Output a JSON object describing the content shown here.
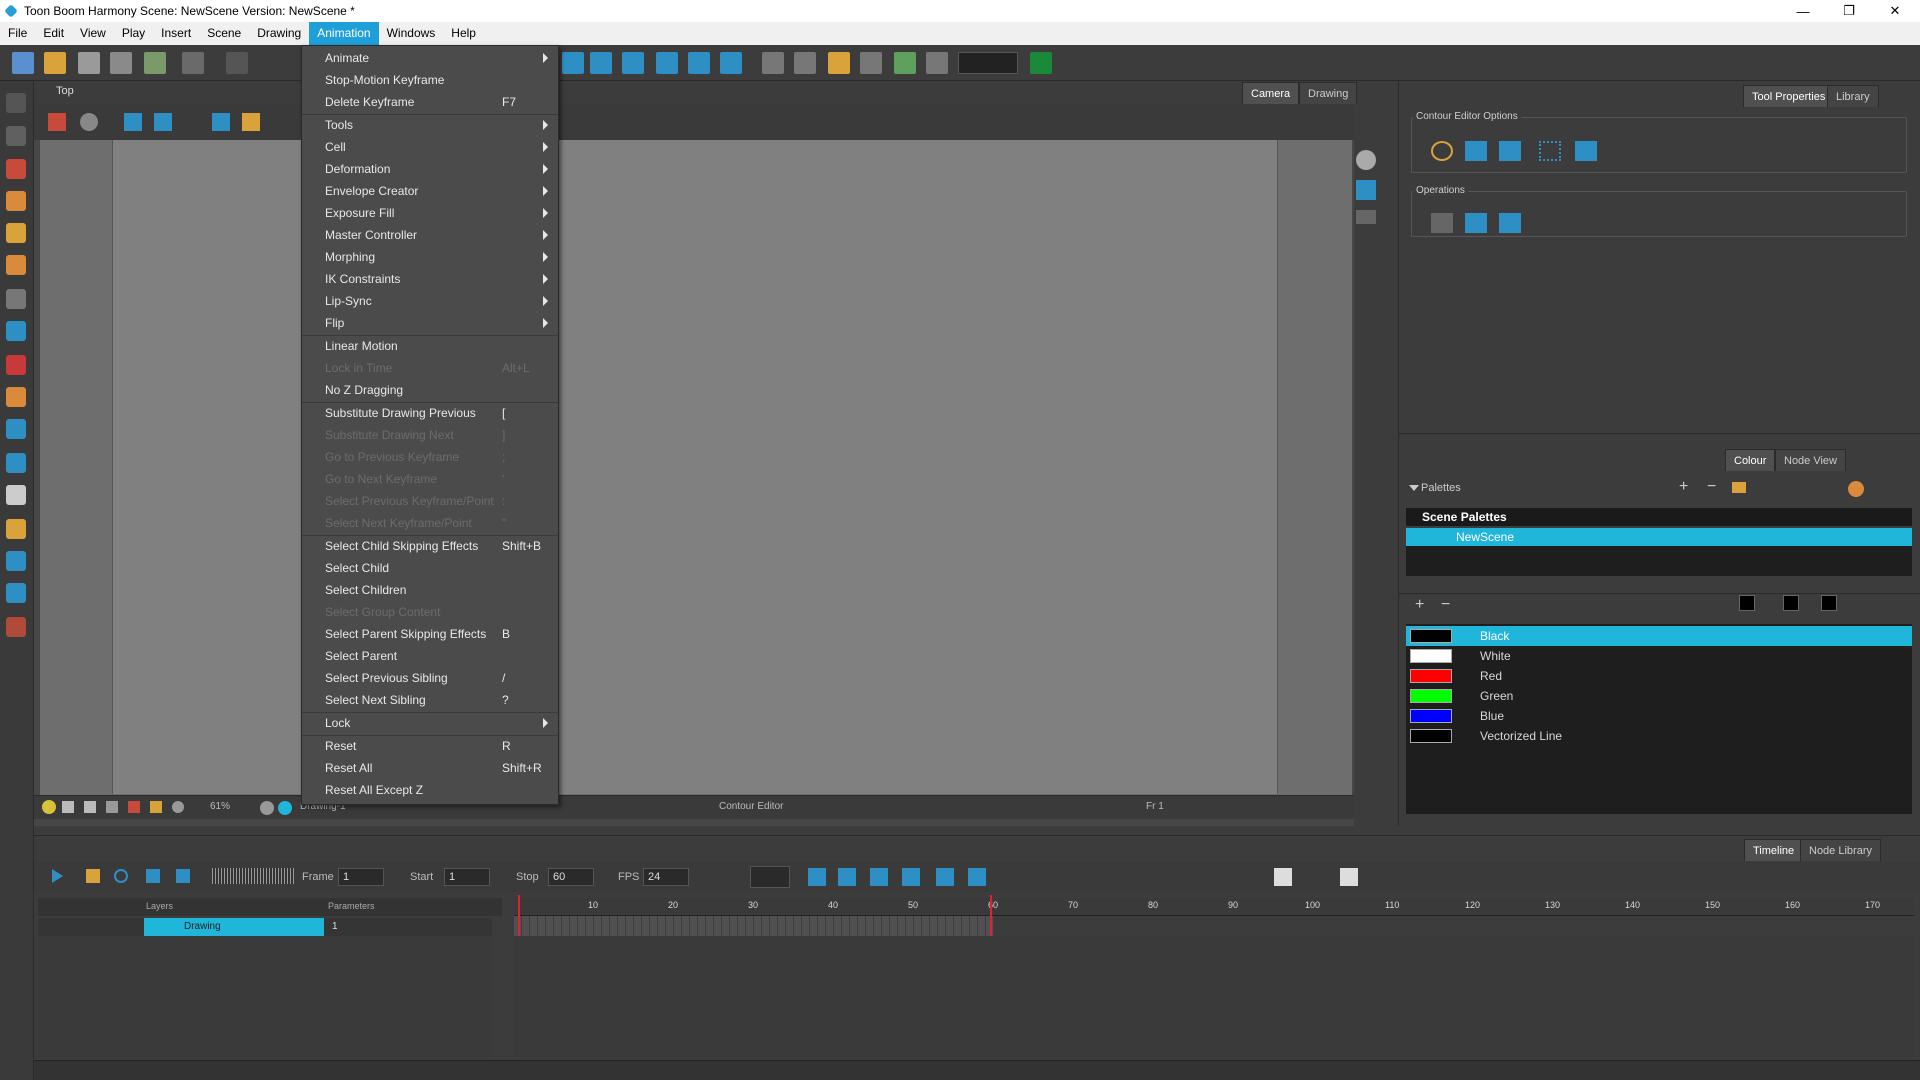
{
  "window": {
    "title": "Toon Boom Harmony Scene: NewScene Version: NewScene *",
    "minimize": "—",
    "maximize": "❐",
    "close": "✕"
  },
  "menubar": [
    "File",
    "Edit",
    "View",
    "Play",
    "Insert",
    "Scene",
    "Drawing",
    "Animation",
    "Windows",
    "Help"
  ],
  "active_menu": "Animation",
  "dropdown": [
    {
      "label": "Animate",
      "shortcut": "",
      "submenu": true,
      "enabled": true
    },
    {
      "label": "Stop-Motion Keyframe",
      "shortcut": "",
      "submenu": false,
      "enabled": true
    },
    {
      "label": "Delete Keyframe",
      "shortcut": "F7",
      "submenu": false,
      "enabled": true
    },
    {
      "label": "Tools",
      "shortcut": "",
      "submenu": true,
      "enabled": true,
      "sep": true
    },
    {
      "label": "Cell",
      "shortcut": "",
      "submenu": true,
      "enabled": true
    },
    {
      "label": "Deformation",
      "shortcut": "",
      "submenu": true,
      "enabled": true
    },
    {
      "label": "Envelope Creator",
      "shortcut": "",
      "submenu": true,
      "enabled": true
    },
    {
      "label": "Exposure Fill",
      "shortcut": "",
      "submenu": true,
      "enabled": true
    },
    {
      "label": "Master Controller",
      "shortcut": "",
      "submenu": true,
      "enabled": true
    },
    {
      "label": "Morphing",
      "shortcut": "",
      "submenu": true,
      "enabled": true
    },
    {
      "label": "IK Constraints",
      "shortcut": "",
      "submenu": true,
      "enabled": true
    },
    {
      "label": "Lip-Sync",
      "shortcut": "",
      "submenu": true,
      "enabled": true
    },
    {
      "label": "Flip",
      "shortcut": "",
      "submenu": true,
      "enabled": true
    },
    {
      "label": "Linear Motion",
      "shortcut": "",
      "submenu": false,
      "enabled": true,
      "sep": true
    },
    {
      "label": "Lock in Time",
      "shortcut": "Alt+L",
      "submenu": false,
      "enabled": false
    },
    {
      "label": "No Z Dragging",
      "shortcut": "",
      "submenu": false,
      "enabled": true
    },
    {
      "label": "Substitute Drawing Previous",
      "shortcut": "[",
      "submenu": false,
      "enabled": true,
      "sep": true
    },
    {
      "label": "Substitute Drawing Next",
      "shortcut": "]",
      "submenu": false,
      "enabled": false
    },
    {
      "label": "Go to Previous Keyframe",
      "shortcut": ";",
      "submenu": false,
      "enabled": false
    },
    {
      "label": "Go to Next Keyframe",
      "shortcut": "'",
      "submenu": false,
      "enabled": false
    },
    {
      "label": "Select Previous Keyframe/Point",
      "shortcut": ":",
      "submenu": false,
      "enabled": false
    },
    {
      "label": "Select Next Keyframe/Point",
      "shortcut": "\"",
      "submenu": false,
      "enabled": false
    },
    {
      "label": "Select Child Skipping Effects",
      "shortcut": "Shift+B",
      "submenu": false,
      "enabled": true,
      "sep": true
    },
    {
      "label": "Select Child",
      "shortcut": "",
      "submenu": false,
      "enabled": true
    },
    {
      "label": "Select Children",
      "shortcut": "",
      "submenu": false,
      "enabled": true
    },
    {
      "label": "Select Group Content",
      "shortcut": "",
      "submenu": false,
      "enabled": false
    },
    {
      "label": "Select Parent Skipping Effects",
      "shortcut": "B",
      "submenu": false,
      "enabled": true
    },
    {
      "label": "Select Parent",
      "shortcut": "",
      "submenu": false,
      "enabled": true
    },
    {
      "label": "Select Previous Sibling",
      "shortcut": "/",
      "submenu": false,
      "enabled": true
    },
    {
      "label": "Select Next Sibling",
      "shortcut": "?",
      "submenu": false,
      "enabled": true
    },
    {
      "label": "Lock",
      "shortcut": "",
      "submenu": true,
      "enabled": true,
      "sep": true
    },
    {
      "label": "Reset",
      "shortcut": "R",
      "submenu": false,
      "enabled": true,
      "sep": true
    },
    {
      "label": "Reset All",
      "shortcut": "Shift+R",
      "submenu": false,
      "enabled": true
    },
    {
      "label": "Reset All Except Z",
      "shortcut": "",
      "submenu": false,
      "enabled": true
    }
  ],
  "view": {
    "top_label": "Top",
    "tabs": [
      "Camera",
      "Drawing"
    ],
    "zoom": "61%",
    "drawing_name": "Drawing-1",
    "tool_name": "Contour Editor",
    "frame_indicator": "Fr 1"
  },
  "right_panel": {
    "tabs": [
      "Tool Properties",
      "Library"
    ],
    "contour_editor_options": "Contour Editor Options",
    "operations": "Operations"
  },
  "colour_panel": {
    "tabs": [
      "Colour",
      "Node View"
    ],
    "palettes_label": "Palettes",
    "scene_palettes": "Scene Palettes",
    "palette_name": "NewScene",
    "swatches": [
      {
        "name": "Black",
        "color": "#000000",
        "selected": true
      },
      {
        "name": "White",
        "color": "#ffffff",
        "selected": false
      },
      {
        "name": "Red",
        "color": "#ff0000",
        "selected": false
      },
      {
        "name": "Green",
        "color": "#00ff00",
        "selected": false
      },
      {
        "name": "Blue",
        "color": "#0000ff",
        "selected": false
      },
      {
        "name": "Vectorized Line",
        "color": "#000000",
        "selected": false
      }
    ]
  },
  "timeline": {
    "tabs": [
      "Timeline",
      "Node Library"
    ],
    "frame_label": "Frame",
    "frame_value": "1",
    "start_label": "Start",
    "start_value": "1",
    "stop_label": "Stop",
    "stop_value": "60",
    "fps_label": "FPS",
    "fps_value": "24",
    "layers_label": "Layers",
    "parameters_label": "Parameters",
    "layer_name": "Drawing",
    "layer_cell": "1",
    "ruler_marks": [
      "10",
      "20",
      "30",
      "40",
      "50",
      "60",
      "70",
      "80",
      "90",
      "100",
      "110",
      "120",
      "130",
      "140",
      "150",
      "160",
      "170"
    ]
  },
  "accent_color": "#1fb6da"
}
